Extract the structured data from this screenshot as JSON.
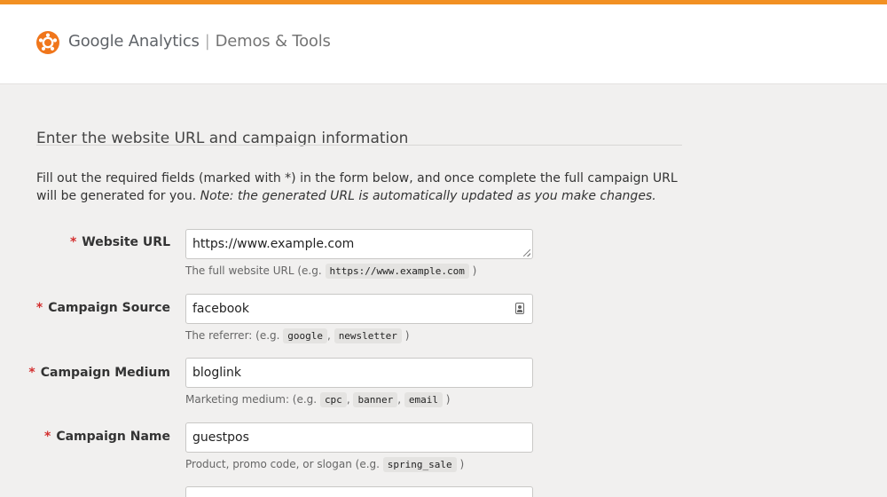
{
  "header": {
    "brand_name": "Google Analytics",
    "separator": "|",
    "product": "Demos & Tools",
    "logo_icon": "analytics-logo-icon",
    "accent_color": "#f29022"
  },
  "section": {
    "title": "Enter the website URL and campaign information",
    "intro_text": "Fill out the required fields (marked with *) in the form below, and once complete the full campaign URL will be generated for you.",
    "intro_note": "Note: the generated URL is automatically updated as you make changes."
  },
  "fields": [
    {
      "required_mark": "*",
      "label": "Website URL",
      "value": "https://www.example.com",
      "hint_prefix": "The full website URL (e.g.",
      "hint_codes": [
        "https://www.example.com"
      ],
      "hint_suffix": ")"
    },
    {
      "required_mark": "*",
      "label": "Campaign Source",
      "value": "facebook",
      "hint_prefix": "The referrer: (e.g.",
      "hint_codes": [
        "google",
        "newsletter"
      ],
      "hint_suffix": ")"
    },
    {
      "required_mark": "*",
      "label": "Campaign Medium",
      "value": "bloglink",
      "hint_prefix": "Marketing medium: (e.g.",
      "hint_codes": [
        "cpc",
        "banner",
        "email"
      ],
      "hint_suffix": ")"
    },
    {
      "required_mark": "*",
      "label": "Campaign Name",
      "value": "guestpos",
      "hint_prefix": "Product, promo code, or slogan (e.g.",
      "hint_codes": [
        "spring_sale"
      ],
      "hint_suffix": ")"
    },
    {
      "value": ""
    }
  ]
}
